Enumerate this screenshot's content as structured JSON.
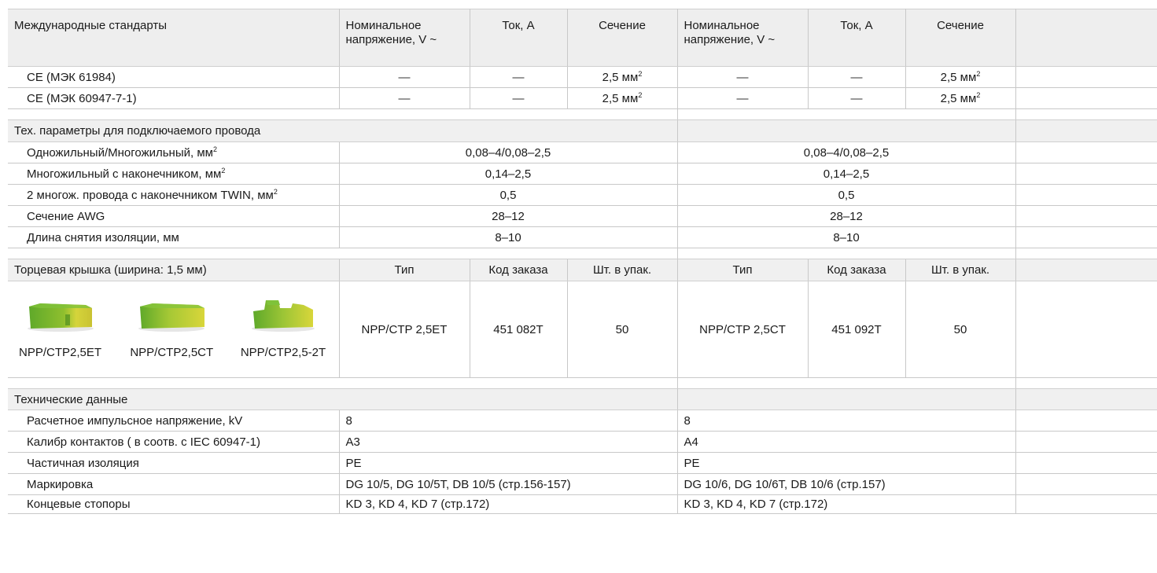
{
  "standards": {
    "header": {
      "title": "Международные стандарты",
      "voltage_a": "Номинальное напряжение, V ~",
      "current_a": "Ток, А",
      "section_a": "Сечение",
      "voltage_b": "Номинальное напряжение, V ~",
      "current_b": "Ток, А",
      "section_b": "Сечение"
    },
    "rows": [
      {
        "name": "CE (МЭК 61984)",
        "voltage_a": "—",
        "current_a": "—",
        "section_a": "2,5 мм",
        "voltage_b": "—",
        "current_b": "—",
        "section_b": "2,5 мм",
        "sup": "2"
      },
      {
        "name": "CE (МЭК 60947-7-1)",
        "voltage_a": "—",
        "current_a": "—",
        "section_a": "2,5 мм",
        "voltage_b": "—",
        "current_b": "—",
        "section_b": "2,5 мм",
        "sup": "2"
      }
    ]
  },
  "wire": {
    "title": "Тех. параметры для подключаемого провода",
    "rows": [
      {
        "name": "Одножильный/Многожильный, мм",
        "sup": "2",
        "a": "0,08–4/0,08–2,5",
        "b": "0,08–4/0,08–2,5"
      },
      {
        "name": "Многожильный с наконечником, мм",
        "sup": "2",
        "a": "0,14–2,5",
        "b": "0,14–2,5"
      },
      {
        "name": "2 многож. провода с наконечником TWIN, мм",
        "sup": "2",
        "a": "0,5",
        "b": "0,5"
      },
      {
        "name": "Сечение AWG",
        "sup": "",
        "a": "28–12",
        "b": "28–12"
      },
      {
        "name": "Длина снятия изоляции, мм",
        "sup": "",
        "a": "8–10",
        "b": "8–10"
      }
    ]
  },
  "endcap": {
    "title": "Торцевая крышка (ширина: 1,5 мм)",
    "type_a": "Тип",
    "code_a": "Код заказа",
    "qty_a": "Шт. в упак.",
    "type_b": "Тип",
    "code_b": "Код заказа",
    "qty_b": "Шт. в упак.",
    "images": [
      {
        "label": "NPP/CTP2,5ET",
        "icon": "end-cover-flat"
      },
      {
        "label": "NPP/CTP2,5CT",
        "icon": "end-cover-flat"
      },
      {
        "label": "NPP/CTP2,5-2T",
        "icon": "end-cover-stepped"
      }
    ],
    "row": {
      "type_a": "NPP/CTP 2,5ET",
      "code_a": "451 082T",
      "qty_a": "50",
      "type_b": "NPP/CTP 2,5CT",
      "code_b": "451 092T",
      "qty_b": "50"
    },
    "colors": {
      "green": "#6fb62c",
      "yellow": "#d9d63a"
    }
  },
  "tech": {
    "title": "Технические данные",
    "rows": [
      {
        "name": "Расчетное импульсное напряжение, kV",
        "a": "8",
        "b": "8"
      },
      {
        "name": "Калибр контактов ( в соотв. с IEC 60947-1)",
        "a": "A3",
        "b": "A4"
      },
      {
        "name": "Частичная изоляция",
        "a": "PE",
        "b": "PE"
      },
      {
        "name": "Маркировка",
        "a": "DG 10/5, DG 10/5T, DB 10/5 (стр.156-157)",
        "b": "DG 10/6, DG 10/6T, DB 10/6 (стр.157)"
      },
      {
        "name": "Концевые стопоры",
        "a": "KD 3, KD 4, KD 7 (стр.172)",
        "b": "KD 3, KD 4, KD 7 (стр.172)"
      }
    ]
  }
}
